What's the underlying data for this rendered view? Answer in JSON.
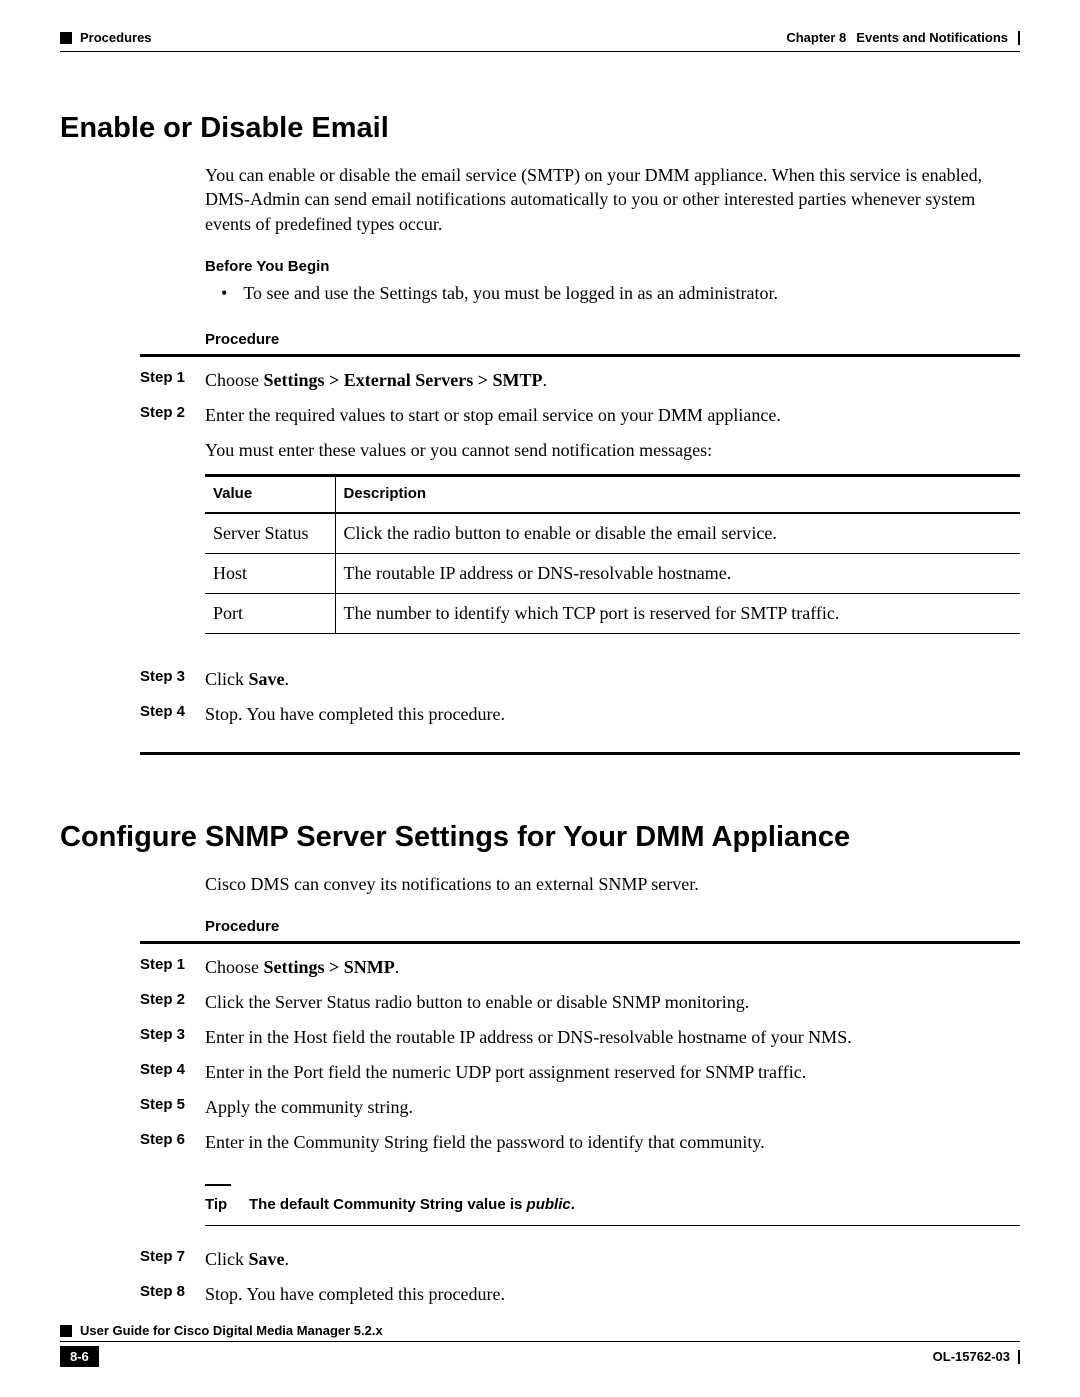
{
  "header": {
    "left_section": "Procedures",
    "right_chapter": "Chapter 8",
    "right_title": "Events and Notifications"
  },
  "section1": {
    "heading": "Enable or Disable Email",
    "intro": "You can enable or disable the email service (SMTP) on your DMM appliance. When this service is enabled, DMS-Admin can send email notifications automatically to you or other interested parties whenever system events of predefined types occur.",
    "before_label": "Before You Begin",
    "before_bullet": "To see and use the Settings tab, you must be logged in as an administrator.",
    "procedure_label": "Procedure",
    "step1_label": "Step 1",
    "step1_pre": "Choose ",
    "step1_bold": "Settings > External Servers > SMTP",
    "step1_post": ".",
    "step2_label": "Step 2",
    "step2_line1": "Enter the required values to start or stop email service on your DMM appliance.",
    "step2_line2": "You must enter these values or you cannot send notification messages:",
    "table": {
      "col1": "Value",
      "col2": "Description",
      "rows": [
        {
          "v": "Server Status",
          "d": "Click the radio button to enable or disable the email service."
        },
        {
          "v": "Host",
          "d": "The routable IP address or DNS-resolvable hostname."
        },
        {
          "v": "Port",
          "d": "The number to identify which TCP port is reserved for SMTP traffic."
        }
      ]
    },
    "step3_label": "Step 3",
    "step3_pre": "Click ",
    "step3_bold": "Save",
    "step3_post": ".",
    "step4_label": "Step 4",
    "step4_text": "Stop. You have completed this procedure."
  },
  "section2": {
    "heading": "Configure SNMP Server Settings for Your DMM Appliance",
    "intro": "Cisco DMS can convey its notifications to an external SNMP server.",
    "procedure_label": "Procedure",
    "steps": [
      {
        "label": "Step 1",
        "pre": "Choose ",
        "bold": "Settings > SNMP",
        "post": "."
      },
      {
        "label": "Step 2",
        "text": "Click the Server Status radio button to enable or disable SNMP monitoring."
      },
      {
        "label": "Step 3",
        "text": "Enter in the Host field the routable IP address or DNS-resolvable hostname of your NMS."
      },
      {
        "label": "Step 4",
        "text": "Enter in the Port field the numeric UDP port assignment reserved for SNMP traffic."
      },
      {
        "label": "Step 5",
        "text": "Apply the community string."
      },
      {
        "label": "Step 6",
        "text": "Enter in the Community String field the password to identify that community."
      }
    ],
    "tip_label": "Tip",
    "tip_pre": "The default Community String value is ",
    "tip_italic": "public",
    "tip_post": ".",
    "step7_label": "Step 7",
    "step7_pre": "Click ",
    "step7_bold": "Save",
    "step7_post": ".",
    "step8_label": "Step 8",
    "step8_text": "Stop. You have completed this procedure."
  },
  "footer": {
    "guide_title": "User Guide for Cisco Digital Media Manager 5.2.x",
    "page_number": "8-6",
    "doc_id": "OL-15762-03"
  }
}
